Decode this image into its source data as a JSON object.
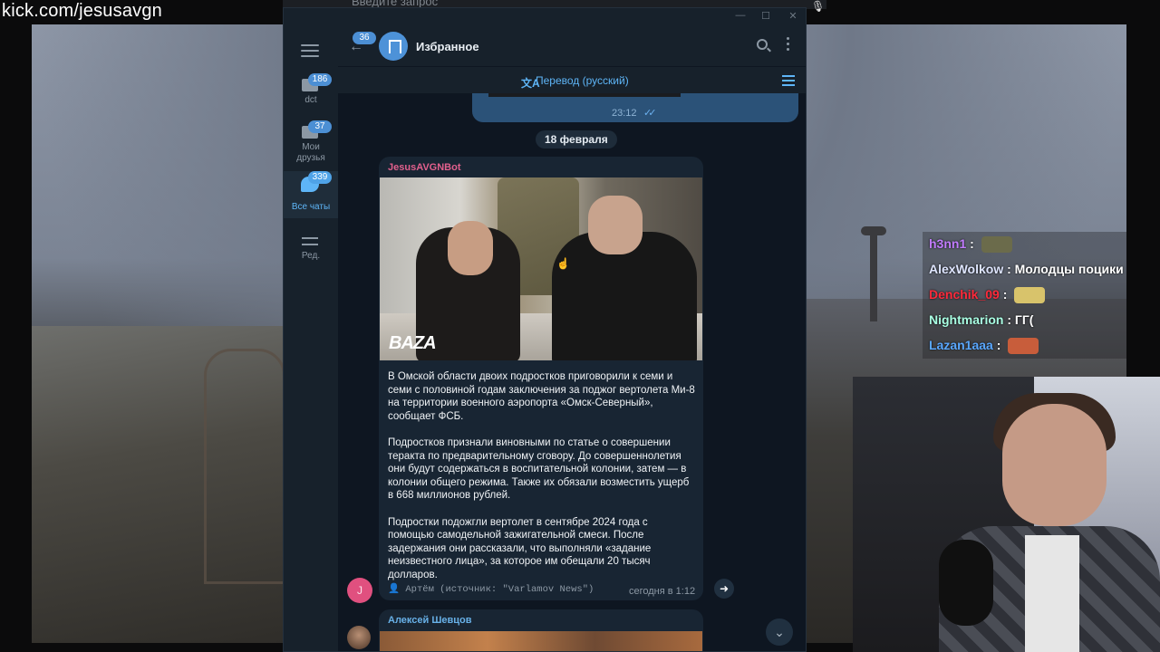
{
  "site_label": "kick.com/jesusavgn",
  "top_search_placeholder": "Введите запрос",
  "window": {
    "controls": [
      "—",
      "☐",
      "✕"
    ],
    "title": "Избранное",
    "back_badge": "36",
    "translate_label": "Перевод (русский)",
    "translate_icon": "文A"
  },
  "folders": [
    {
      "label": "dct",
      "badge": "186",
      "icon": "folder-icon"
    },
    {
      "label": "Мои друзья",
      "badge": "37",
      "icon": "folder-icon"
    },
    {
      "label": "Все чаты",
      "badge": "339",
      "icon": "chat-bubbles-icon",
      "active": true
    },
    {
      "label": "Ред.",
      "icon": "sliders-icon"
    }
  ],
  "outgoing": {
    "time": "23:12",
    "status_icon": "double-check-icon"
  },
  "date_chip": "18 февраля",
  "message": {
    "sender": "JesusAVGNBot",
    "photo_logo": "BAZA",
    "paragraphs": [
      "В Омской области двоих подростков приговорили к семи и семи с половиной годам заключения за поджог вертолета Ми-8 на территории военного аэропорта «Омск-Северный», сообщает ФСБ.",
      "Подростков признали виновными по статье о совершении теракта по предварительному сговору. До совершеннолетия они будут содержаться в воспитательной колонии, затем — в колонии общего режима. Также их обязали возместить ущерб в 668 миллионов рублей.",
      "Подростки подожгли вертолет в сентябре 2024 года с помощью самодельной зажигательной смеси. После задержания они рассказали, что выполняли «задание неизвестного лица», за которое им обещали 20 тысяч долларов."
    ],
    "source": "👤 Артём (источник: \"Varlamov News\")",
    "time": "сегодня в 1:12",
    "avatar_letter": "J"
  },
  "message2": {
    "sender": "Алексей Шевцов"
  },
  "stream_chat": [
    {
      "user": "h3nn1",
      "user_color": "#c27cff",
      "text": " : ",
      "emote_color": "#6b6b4b"
    },
    {
      "user": "AlexWolkow",
      "user_color": "#dfe6ff",
      "text": " : Молодцы поцики"
    },
    {
      "user": "Denchik_09",
      "user_color": "#ff2a3b",
      "text": " : ",
      "emote_color": "#d8c36b"
    },
    {
      "user": "Nightmarion",
      "user_color": "#a9ffe3",
      "text": " : ГГ("
    },
    {
      "user": "Lazan1aaa",
      "user_color": "#5aa8ff",
      "text": " : ",
      "emote_color": "#c85d3b"
    }
  ],
  "colors": {
    "tg_bg": "#0e1621",
    "tg_panel": "#17212b",
    "accent": "#5eb5f7",
    "out_bubble": "#2b5278",
    "in_bubble": "#182533"
  }
}
